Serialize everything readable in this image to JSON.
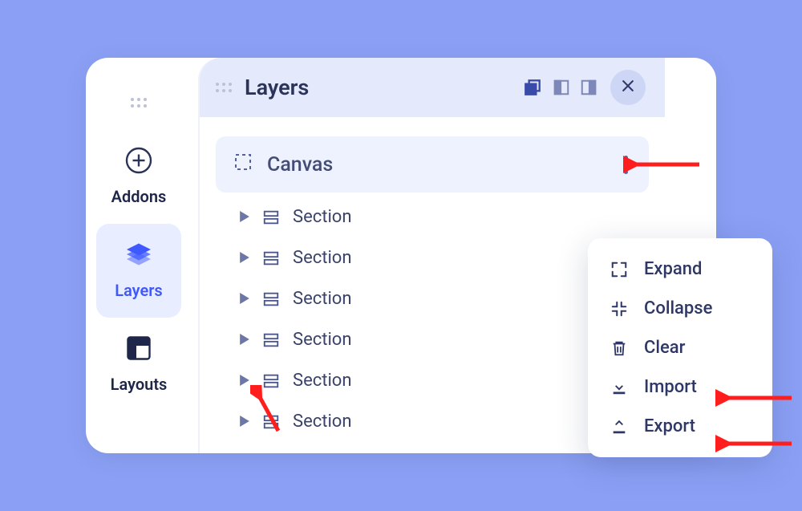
{
  "sidebar": {
    "items": [
      {
        "label": "Addons"
      },
      {
        "label": "Layers"
      },
      {
        "label": "Layouts"
      }
    ]
  },
  "panel": {
    "title": "Layers",
    "canvas_label": "Canvas",
    "sections": [
      {
        "label": "Section"
      },
      {
        "label": "Section"
      },
      {
        "label": "Section"
      },
      {
        "label": "Section"
      },
      {
        "label": "Section"
      },
      {
        "label": "Section"
      }
    ]
  },
  "context_menu": {
    "items": [
      {
        "label": "Expand"
      },
      {
        "label": "Collapse"
      },
      {
        "label": "Clear"
      },
      {
        "label": "Import"
      },
      {
        "label": "Export"
      }
    ]
  }
}
